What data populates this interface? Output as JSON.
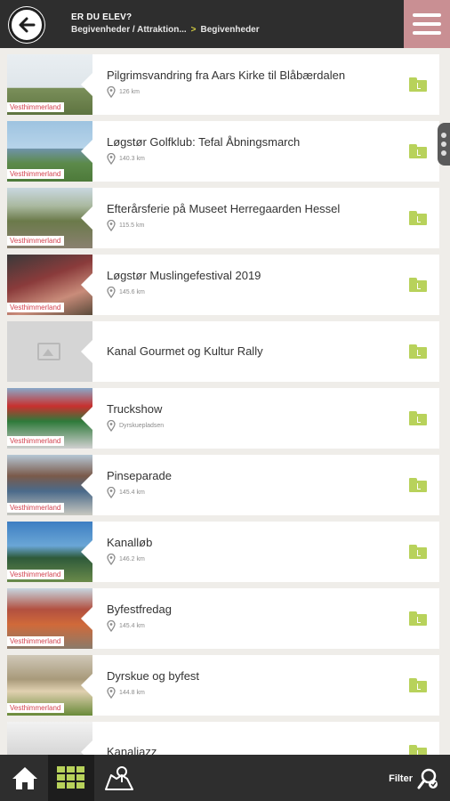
{
  "header": {
    "title": "ER DU ELEV?",
    "breadcrumb_parent": "Begivenheder / Attraktion...",
    "breadcrumb_separator": ">",
    "breadcrumb_current": "Begivenheder",
    "back_icon": "arrow-left-icon",
    "menu_icon": "hamburger-icon",
    "menu_color": "#c98f93"
  },
  "items": [
    {
      "title": "Pilgrimsvandring fra Aars Kirke til Blåbærdalen",
      "distance": "126 km",
      "tag": "Vesthimmerland"
    },
    {
      "title": "Løgstør Golfklub: Tefal Åbningsmarch",
      "distance": "140.3 km",
      "tag": "Vesthimmerland"
    },
    {
      "title": "Efterårsferie på Museet Herregaarden Hessel",
      "distance": "115.5 km",
      "tag": "Vesthimmerland"
    },
    {
      "title": "Løgstør Muslingefestival 2019",
      "distance": "145.6 km",
      "tag": "Vesthimmerland"
    },
    {
      "title": "Kanal Gourmet og Kultur Rally",
      "distance": "",
      "tag": ""
    },
    {
      "title": "Truckshow",
      "distance": "Dyrskuepladsen",
      "tag": "Vesthimmerland"
    },
    {
      "title": "Pinseparade",
      "distance": "145.4 km",
      "tag": "Vesthimmerland"
    },
    {
      "title": "Kanalløb",
      "distance": "146.2 km",
      "tag": "Vesthimmerland"
    },
    {
      "title": "Byfestfredag",
      "distance": "145.4 km",
      "tag": "Vesthimmerland"
    },
    {
      "title": "Dyrskue og byfest",
      "distance": "144.8 km",
      "tag": "Vesthimmerland"
    },
    {
      "title": "Kanaljazz",
      "distance": "",
      "tag": ""
    }
  ],
  "bottom_nav": {
    "home_icon": "home-icon",
    "grid_icon": "grid-icon",
    "map_icon": "map-pin-icon",
    "filter_label": "Filter",
    "filter_icon": "search-pin-icon"
  },
  "colors": {
    "accent_green": "#b8d25b",
    "tag_red": "#d2424f",
    "header_bg": "#2e2e2e"
  }
}
